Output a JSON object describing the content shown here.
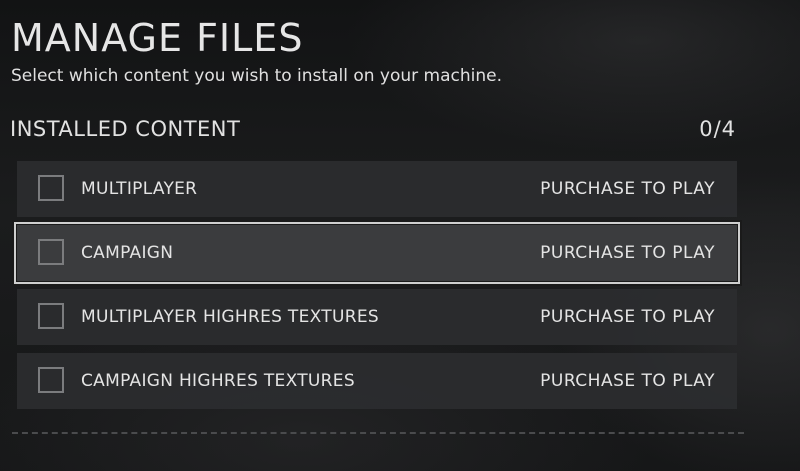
{
  "page": {
    "title": "MANAGE FILES",
    "subtitle": "Select which content you wish to install on your machine."
  },
  "section": {
    "title": "INSTALLED CONTENT",
    "count": "0/4"
  },
  "items": [
    {
      "label": "MULTIPLAYER",
      "status": "PURCHASE TO PLAY",
      "checked": false,
      "selected": false
    },
    {
      "label": "CAMPAIGN",
      "status": "PURCHASE TO PLAY",
      "checked": false,
      "selected": true
    },
    {
      "label": "MULTIPLAYER HIGHRES TEXTURES",
      "status": "PURCHASE TO PLAY",
      "checked": false,
      "selected": false
    },
    {
      "label": "CAMPAIGN HIGHRES TEXTURES",
      "status": "PURCHASE TO PLAY",
      "checked": false,
      "selected": false
    }
  ],
  "colors": {
    "background": "#151617",
    "row": "#2c2d2f",
    "row_selected": "#3c3d3f",
    "selection_outline": "#cfcfcf",
    "checkbox_border": "#7b7c7e",
    "text": "#e4e4e4"
  }
}
